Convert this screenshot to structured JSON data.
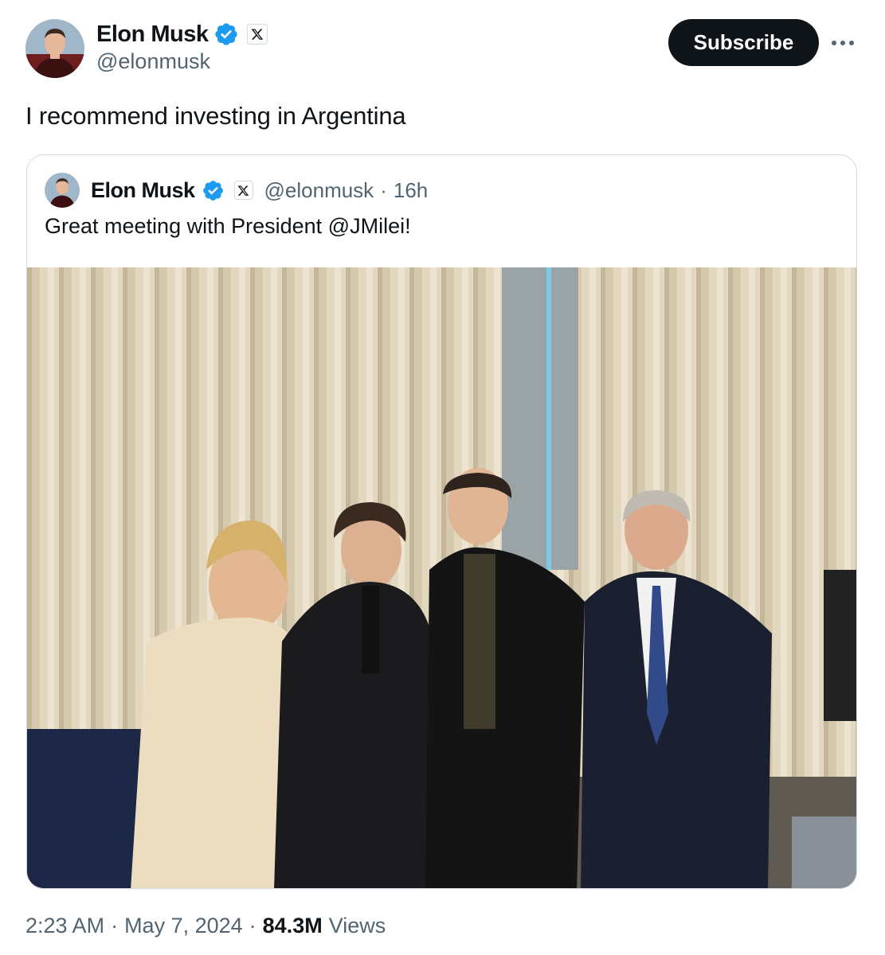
{
  "author": {
    "name": "Elon Musk",
    "handle": "@elonmusk",
    "avatar_icon": "profile-photo"
  },
  "actions": {
    "subscribe_label": "Subscribe",
    "more_icon": "more-horizontal-icon"
  },
  "tweet": {
    "text": "I recommend investing in Argentina"
  },
  "quote": {
    "name": "Elon Musk",
    "handle": "@elonmusk",
    "separator": "·",
    "age": "16h",
    "text": "Great meeting with President @JMilei!"
  },
  "footer": {
    "time": "2:23 AM",
    "sep1": "·",
    "date": "May 7, 2024",
    "sep2": "·",
    "views_count": "84.3M",
    "views_label": "Views"
  },
  "colors": {
    "verified_blue": "#1d9bf0",
    "text_primary": "#0f1419",
    "text_secondary": "#536471",
    "border": "#cfd9de",
    "button_bg": "#0f1419"
  }
}
